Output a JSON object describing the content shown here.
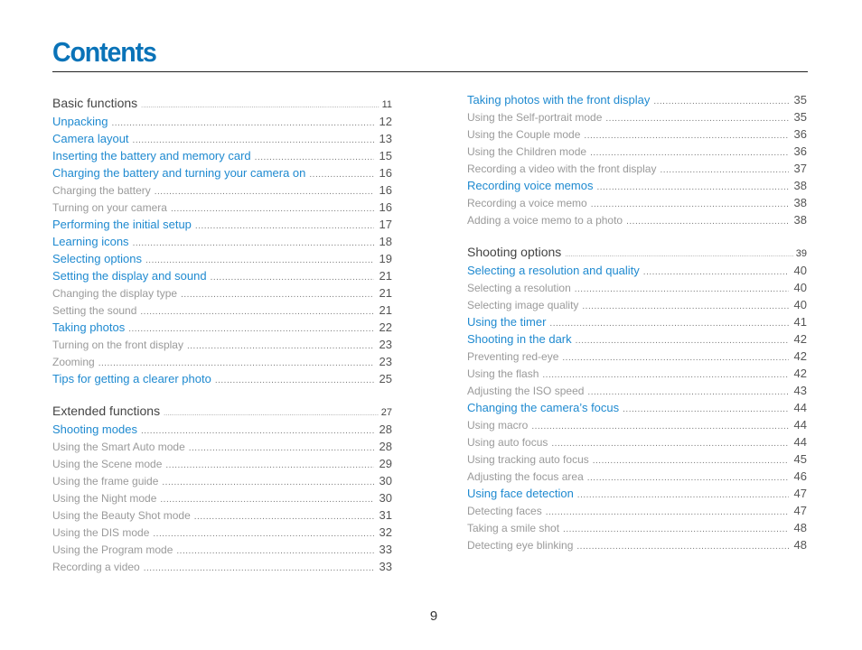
{
  "title": "Contents",
  "page_number": "9",
  "left_column": [
    {
      "level": "section",
      "text": "Basic functions",
      "page": "11"
    },
    {
      "level": "l1",
      "text": "Unpacking",
      "page": "12"
    },
    {
      "level": "l1",
      "text": "Camera layout",
      "page": "13"
    },
    {
      "level": "l1",
      "text": "Inserting the battery and memory card",
      "page": "15"
    },
    {
      "level": "l1",
      "text": "Charging the battery and turning your camera on",
      "page": "16"
    },
    {
      "level": "l2",
      "text": "Charging the battery",
      "page": "16"
    },
    {
      "level": "l2",
      "text": "Turning on your camera",
      "page": "16"
    },
    {
      "level": "l1",
      "text": "Performing the initial setup",
      "page": "17"
    },
    {
      "level": "l1",
      "text": "Learning icons",
      "page": "18"
    },
    {
      "level": "l1",
      "text": "Selecting options",
      "page": "19"
    },
    {
      "level": "l1",
      "text": "Setting the display and sound",
      "page": "21"
    },
    {
      "level": "l2",
      "text": "Changing the display type",
      "page": "21"
    },
    {
      "level": "l2",
      "text": "Setting the sound",
      "page": "21"
    },
    {
      "level": "l1",
      "text": "Taking photos",
      "page": "22"
    },
    {
      "level": "l2",
      "text": "Turning on the front display",
      "page": "23"
    },
    {
      "level": "l2",
      "text": "Zooming",
      "page": "23"
    },
    {
      "level": "l1",
      "text": "Tips for getting a clearer photo",
      "page": "25"
    },
    {
      "level": "gap"
    },
    {
      "level": "section",
      "text": "Extended functions",
      "page": "27"
    },
    {
      "level": "l1",
      "text": "Shooting modes",
      "page": "28"
    },
    {
      "level": "l2",
      "text": "Using the Smart Auto mode",
      "page": "28"
    },
    {
      "level": "l2",
      "text": "Using the Scene mode",
      "page": "29"
    },
    {
      "level": "l2",
      "text": "Using the frame guide",
      "page": "30"
    },
    {
      "level": "l2",
      "text": "Using the Night mode",
      "page": "30"
    },
    {
      "level": "l2",
      "text": "Using the Beauty Shot mode",
      "page": "31"
    },
    {
      "level": "l2",
      "text": "Using the DIS mode",
      "page": "32"
    },
    {
      "level": "l2",
      "text": "Using the Program mode",
      "page": "33"
    },
    {
      "level": "l2",
      "text": "Recording a video",
      "page": "33"
    }
  ],
  "right_column": [
    {
      "level": "l1",
      "text": "Taking photos with the front display",
      "page": "35"
    },
    {
      "level": "l2",
      "text": "Using the Self-portrait mode",
      "page": "35"
    },
    {
      "level": "l2",
      "text": "Using the Couple mode",
      "page": "36"
    },
    {
      "level": "l2",
      "text": "Using the Children mode",
      "page": "36"
    },
    {
      "level": "l2",
      "text": "Recording a video with the front display",
      "page": "37"
    },
    {
      "level": "l1",
      "text": "Recording voice memos",
      "page": "38"
    },
    {
      "level": "l2",
      "text": "Recording a voice memo",
      "page": "38"
    },
    {
      "level": "l2",
      "text": "Adding a voice memo to a photo",
      "page": "38"
    },
    {
      "level": "gap"
    },
    {
      "level": "section",
      "text": "Shooting options",
      "page": "39"
    },
    {
      "level": "l1",
      "text": "Selecting a resolution and quality",
      "page": "40"
    },
    {
      "level": "l2",
      "text": "Selecting a resolution",
      "page": "40"
    },
    {
      "level": "l2",
      "text": "Selecting image quality",
      "page": "40"
    },
    {
      "level": "l1",
      "text": "Using the timer",
      "page": "41"
    },
    {
      "level": "l1",
      "text": "Shooting in the dark",
      "page": "42"
    },
    {
      "level": "l2",
      "text": "Preventing red-eye",
      "page": "42"
    },
    {
      "level": "l2",
      "text": "Using the flash",
      "page": "42"
    },
    {
      "level": "l2",
      "text": "Adjusting the ISO speed",
      "page": "43"
    },
    {
      "level": "l1",
      "text": "Changing the camera’s focus",
      "page": "44"
    },
    {
      "level": "l2",
      "text": "Using macro",
      "page": "44"
    },
    {
      "level": "l2",
      "text": "Using auto focus",
      "page": "44"
    },
    {
      "level": "l2",
      "text": "Using tracking auto focus",
      "page": "45"
    },
    {
      "level": "l2",
      "text": "Adjusting the focus area",
      "page": "46"
    },
    {
      "level": "l1",
      "text": "Using face detection",
      "page": "47"
    },
    {
      "level": "l2",
      "text": "Detecting faces",
      "page": "47"
    },
    {
      "level": "l2",
      "text": "Taking a smile shot",
      "page": "48"
    },
    {
      "level": "l2",
      "text": "Detecting eye blinking",
      "page": "48"
    }
  ]
}
